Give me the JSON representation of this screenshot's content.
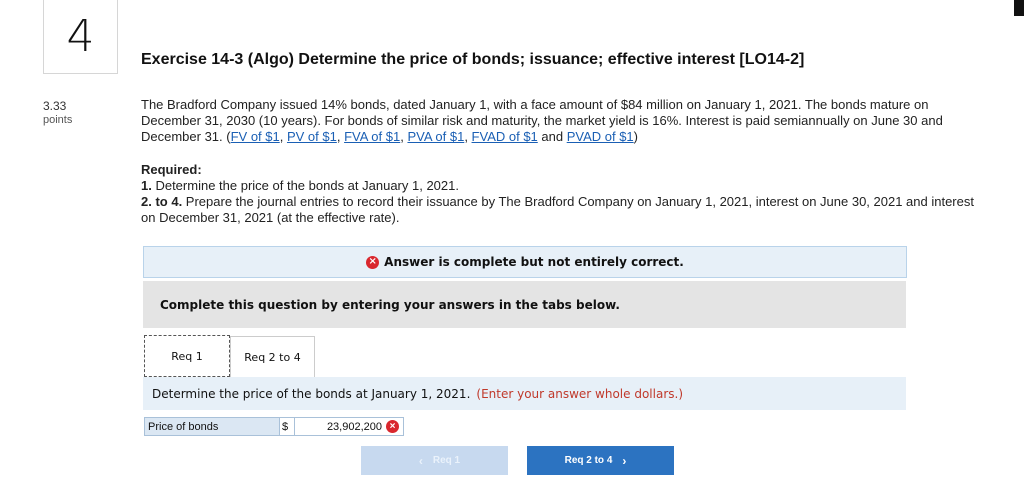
{
  "question": {
    "number": "4",
    "points_value": "3.33",
    "points_label": "points"
  },
  "title": "Exercise 14-3 (Algo) Determine the price of bonds; issuance; effective interest [LO14-2]",
  "problem_text": "The Bradford Company issued 14% bonds, dated January 1, with a face amount of $84 million on January 1, 2021. The bonds mature on December 31, 2030 (10 years). For bonds of similar risk and maturity, the market yield is 16%. Interest is paid semiannually on June 30 and December 31. (",
  "links": {
    "fv": "FV of $1",
    "pv": "PV of $1",
    "fva": "FVA of $1",
    "pva": "PVA of $1",
    "fvad": "FVAD of $1",
    "pvad": "PVAD of $1"
  },
  "link_sep_comma": ", ",
  "link_sep_and": " and ",
  "link_close": ")",
  "required": {
    "heading": "Required:",
    "item1_num": "1.",
    "item1_text": " Determine the price of the bonds at January 1, 2021.",
    "item2_num": "2. to 4.",
    "item2_text": " Prepare the journal entries to record their issuance by The Bradford Company on January 1, 2021, interest on June 30, 2021 and interest on December 31, 2021 (at the effective rate)."
  },
  "banner": {
    "icon": "×",
    "text": "Answer is complete but not entirely correct."
  },
  "instructions": "Complete this question by entering your answers in the tabs below.",
  "tabs": [
    {
      "label": "Req 1"
    },
    {
      "label": "Req 2 to 4"
    }
  ],
  "req1": {
    "question": "Determine the price of the bonds at January 1, 2021.",
    "hint": "(Enter your answer whole dollars.)"
  },
  "price_row": {
    "label": "Price of bonds",
    "currency": "$",
    "value": "23,902,200",
    "status_icon": "×"
  },
  "nav": {
    "prev_label": "Req 1",
    "prev_chevron": "‹",
    "next_label": "Req 2 to 4",
    "next_chevron": "›"
  },
  "colors": {
    "link": "#1a5fb4",
    "error": "#d9272e",
    "info_bg": "#e7f0f8",
    "next_button": "#2c73c1",
    "prev_button": "#c7d9ef"
  }
}
